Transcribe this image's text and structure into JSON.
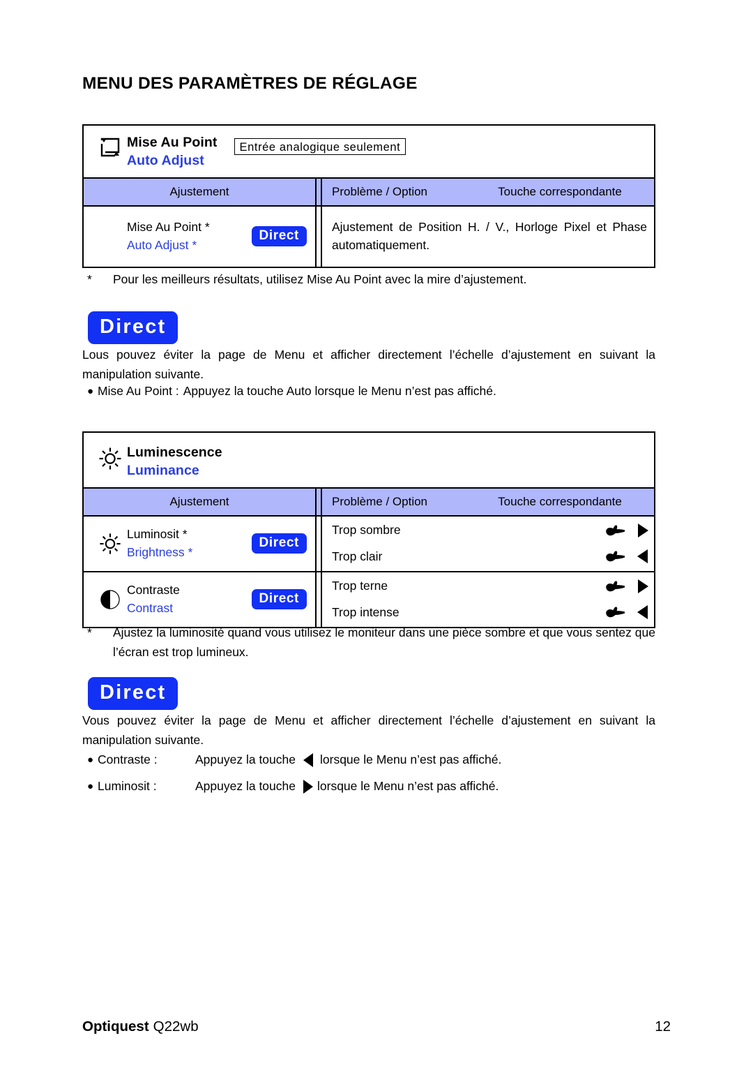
{
  "page": {
    "title": "MENU DES PARAMÈTRES DE RÉGLAGE"
  },
  "tables": [
    {
      "id": "mise-au-point",
      "icon": "auto-adjust-loop-icon",
      "title_fr": "Mise Au Point",
      "title_en": "Auto Adjust",
      "note": "Entrée analogique seulement",
      "columns": {
        "adjustment": "Ajustement",
        "problem_option": "Problème / Option",
        "matching_key": "Touche correspondante"
      },
      "rows": [
        {
          "icon": "",
          "label_fr": "Mise Au Point *",
          "label_en": "Auto Adjust *",
          "badge": "Direct",
          "options": [
            {
              "text": "Ajustement de Position H. / V., Horloge Pixel et Phase automatiquement.",
              "keys": []
            }
          ]
        }
      ]
    },
    {
      "id": "luminescence",
      "icon": "sun-brightness-icon",
      "title_fr": "Luminescence",
      "title_en": "Luminance",
      "note": "",
      "columns": {
        "adjustment": "Ajustement",
        "problem_option": "Problème / Option",
        "matching_key": "Touche correspondante"
      },
      "rows": [
        {
          "icon": "sun-brightness-icon",
          "label_fr": "Luminosit *",
          "label_en": "Brightness *",
          "badge": "Direct",
          "options": [
            {
              "text": "Trop sombre",
              "keys": [
                "hand-pointer-icon",
                "triangle-right-icon"
              ]
            },
            {
              "text": "Trop clair",
              "keys": [
                "hand-pointer-icon",
                "triangle-left-icon"
              ]
            }
          ]
        },
        {
          "icon": "contrast-half-circle-icon",
          "label_fr": "Contraste",
          "label_en": "Contrast",
          "badge": "Direct",
          "options": [
            {
              "text": "Trop terne",
              "keys": [
                "hand-pointer-icon",
                "triangle-right-icon"
              ]
            },
            {
              "text": "Trop intense",
              "keys": [
                "hand-pointer-icon",
                "triangle-left-icon"
              ]
            }
          ]
        }
      ]
    }
  ],
  "notes": {
    "star_symbol": "*",
    "note1": "Pour les meilleurs résultats, utilisez Mise Au Point avec la mire d’ajustement.",
    "note2": "Ajustez la luminosité quand vous utilisez le moniteur dans une pièce sombre et que vous sentez que l’écran est trop lumineux."
  },
  "direct_sections": [
    {
      "badge": "Direct",
      "paragraph": "Lous pouvez éviter la page de Menu et afficher directement l’échelle d’ajustement en suivant la manipulation suivante.",
      "bullets": [
        {
          "dot": "●",
          "label": "Mise Au Point :",
          "text_before": "Appuyez la touche Auto lorsque le Menu n’est pas affiché.",
          "glyph": "",
          "text_after": ""
        }
      ]
    },
    {
      "badge": "Direct",
      "paragraph": "Vous pouvez éviter la page de Menu et afficher directement l’échelle d’ajustement en suivant la manipulation suivante.",
      "bullets": [
        {
          "dot": "●",
          "label": "Contraste :",
          "text_before": "Appuyez la touche",
          "glyph": "triangle-left-icon",
          "text_after": "lorsque le Menu n’est pas affiché."
        },
        {
          "dot": "●",
          "label": "Luminosit :",
          "text_before": "Appuyez la touche",
          "glyph": "triangle-right-icon",
          "text_after": "lorsque le Menu n’est pas affiché."
        }
      ]
    }
  ],
  "footer": {
    "brand": "Optiquest",
    "model": "Q22wb",
    "page_number": "12"
  },
  "colors": {
    "header_band": "#b0b7fb",
    "accent_blue": "#2b3fe0",
    "badge_blue": "#1330f5",
    "text": "#000000"
  }
}
